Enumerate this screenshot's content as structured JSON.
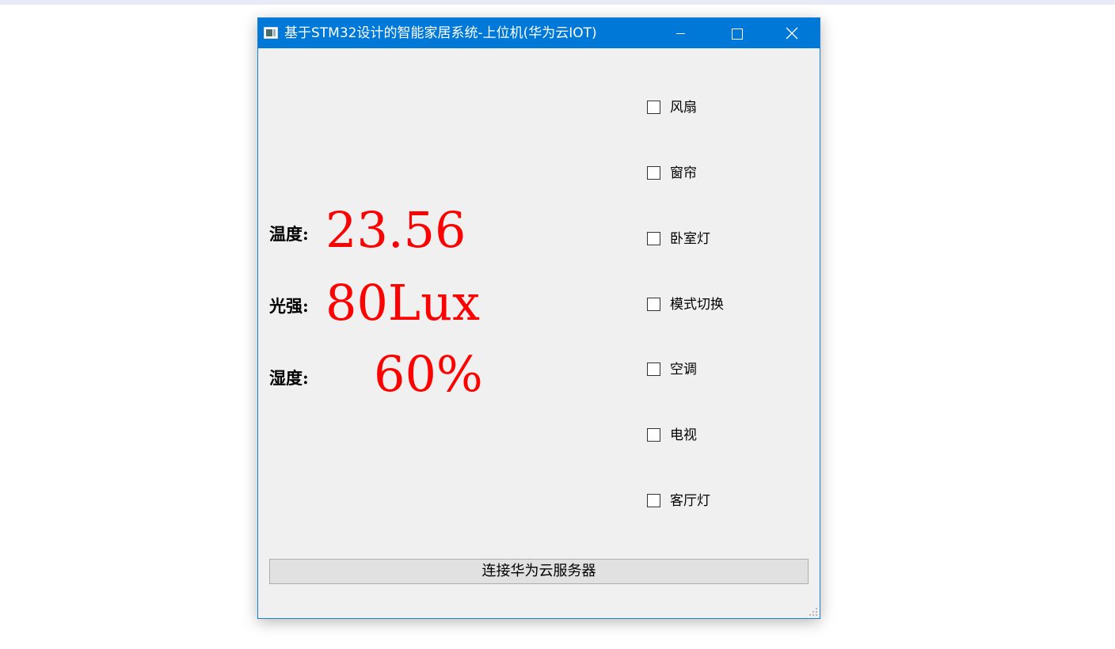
{
  "window": {
    "title": "基于STM32设计的智能家居系统-上位机(华为云IOT)",
    "accent_color": "#0078d7",
    "icons": {
      "app": "app-window-icon",
      "minimize": "minimize-icon",
      "maximize": "maximize-icon",
      "close": "close-icon",
      "size_grip": "size-grip-icon"
    }
  },
  "sensors": [
    {
      "label": "温度:",
      "value": "23.56"
    },
    {
      "label": "光强:",
      "value": "80Lux"
    },
    {
      "label": "湿度:",
      "value": "60%"
    }
  ],
  "sensor_value_color": "#ff0000",
  "controls": [
    {
      "label": "风扇",
      "checked": false
    },
    {
      "label": "窗帘",
      "checked": false
    },
    {
      "label": "卧室灯",
      "checked": false
    },
    {
      "label": "模式切换",
      "checked": false
    },
    {
      "label": "空调",
      "checked": false
    },
    {
      "label": "电视",
      "checked": false
    },
    {
      "label": "客厅灯",
      "checked": false
    }
  ],
  "connect_button": {
    "label": "连接华为云服务器"
  }
}
